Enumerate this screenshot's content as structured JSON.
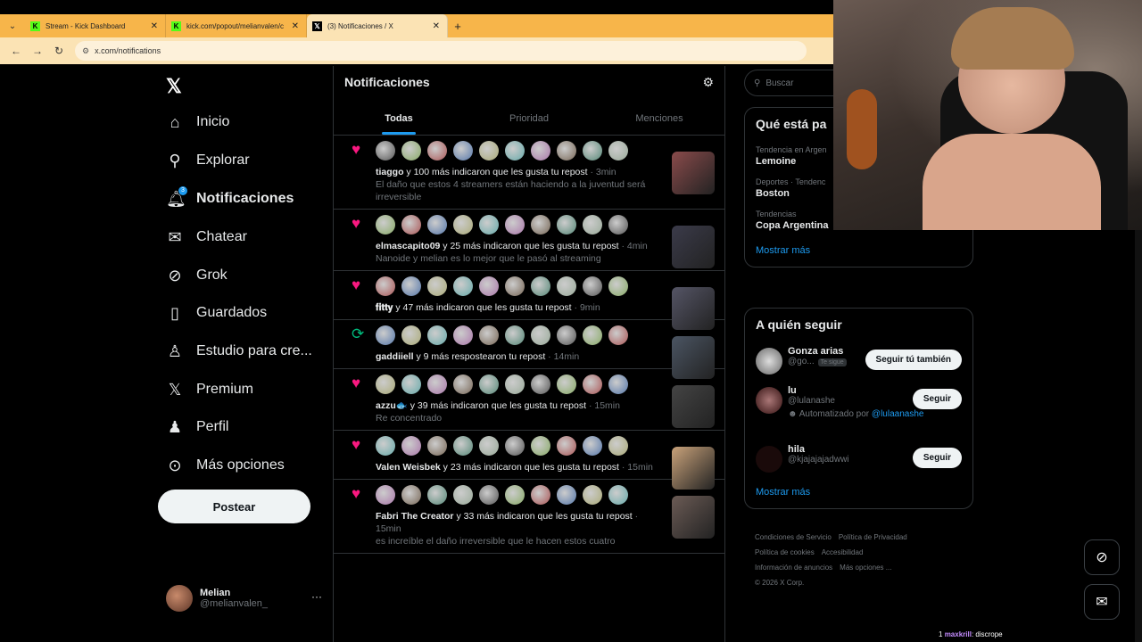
{
  "browser": {
    "tabs": [
      {
        "label": "Stream - Kick Dashboard",
        "favicon": "kick-icon",
        "active": false
      },
      {
        "label": "kick.com/popout/melianvalen/c",
        "favicon": "kick-icon",
        "active": false
      },
      {
        "label": "(3) Notificaciones / X",
        "favicon": "x-icon",
        "active": true
      }
    ],
    "url": "x.com/notifications"
  },
  "nav": {
    "items": [
      {
        "label": "Inicio",
        "icon": "home-icon"
      },
      {
        "label": "Explorar",
        "icon": "search-icon"
      },
      {
        "label": "Notificaciones",
        "icon": "bell-icon",
        "badge": "3"
      },
      {
        "label": "Chatear",
        "icon": "mail-icon"
      },
      {
        "label": "Grok",
        "icon": "grok-icon"
      },
      {
        "label": "Guardados",
        "icon": "bookmark-icon"
      },
      {
        "label": "Estudio para cre...",
        "icon": "creator-icon"
      },
      {
        "label": "Premium",
        "icon": "x-icon"
      },
      {
        "label": "Perfil",
        "icon": "person-icon"
      },
      {
        "label": "Más opciones",
        "icon": "more-circle-icon"
      }
    ],
    "post_label": "Postear",
    "account": {
      "name": "Melian",
      "handle": "@melianvalen_"
    }
  },
  "main": {
    "title": "Notificaciones",
    "tabs": [
      "Todas",
      "Prioridad",
      "Menciones"
    ],
    "notifications": [
      {
        "kind": "like",
        "avatars": 10,
        "user": "tiaggo",
        "text": " y 100 más indicaron que les gusta tu repost",
        "time": " · 3min",
        "sub": "El daño que estos 4 streamers están haciendo a la juventud será irreversible"
      },
      {
        "kind": "like",
        "avatars": 10,
        "user": "elmascapito09",
        "text": " y 25 más indicaron que les gusta tu repost",
        "time": " · 4min",
        "sub": "Nanoide y melian es lo mejor que le pasó al streaming"
      },
      {
        "kind": "like",
        "avatars": 10,
        "user": "𝐟𝐢𝐭𝐭𝐲",
        "text": " y 47 más indicaron que les gusta tu repost",
        "time": " · 9min",
        "sub": ""
      },
      {
        "kind": "rt",
        "avatars": 10,
        "user": "gaddiiell",
        "text": " y 9 más respostearon tu repost",
        "time": " · 14min",
        "sub": ""
      },
      {
        "kind": "like",
        "avatars": 10,
        "user": "azzu🐟",
        "text": " y 39 más indicaron que les gusta tu repost",
        "time": " · 15min",
        "sub": "Re concentrado"
      },
      {
        "kind": "like",
        "avatars": 10,
        "user": "Valen Weisbek",
        "text": " y 23 más indicaron que les gusta tu repost",
        "time": " · 15min",
        "sub": ""
      },
      {
        "kind": "like",
        "avatars": 10,
        "user": "Fabri The Creator",
        "text": " y 33 más indicaron que les gusta tu repost",
        "time": " · 15min",
        "sub": "es increíble el daño irreversible que le hacen estos cuatro"
      }
    ]
  },
  "sidebar": {
    "search_placeholder": "Buscar",
    "trends_title": "Qué está pa",
    "trends": [
      {
        "context": "Tendencia en Argen",
        "name": "Lemoine"
      },
      {
        "context": "Deportes · Tendenc",
        "name": "Boston"
      },
      {
        "context": "Tendencias",
        "name": "Copa Argentina"
      }
    ],
    "show_more": "Mostrar más",
    "who_title": "A quién seguir",
    "who": [
      {
        "name": "Gonza arias",
        "handle": "@go...",
        "badge": "Te sigue",
        "button": "Seguir tú también"
      },
      {
        "name": "lu",
        "handle": "@lulanashe",
        "auto_prefix": "Automatizado por ",
        "auto_link": "@lulaanashe",
        "button": "Seguir"
      },
      {
        "name": "hila",
        "handle": "@kjajajajadwwi",
        "button": "Seguir"
      }
    ],
    "footer": [
      "Condiciones de Servicio",
      "Política de Privacidad",
      "Política de cookies",
      "Accesibilidad",
      "Información de anuncios",
      "Más opciones ...",
      "© 2026 X Corp."
    ]
  },
  "overlay": {
    "chat_user": "maxkrill",
    "chat_text": ": discrope",
    "chat_count": "1"
  }
}
